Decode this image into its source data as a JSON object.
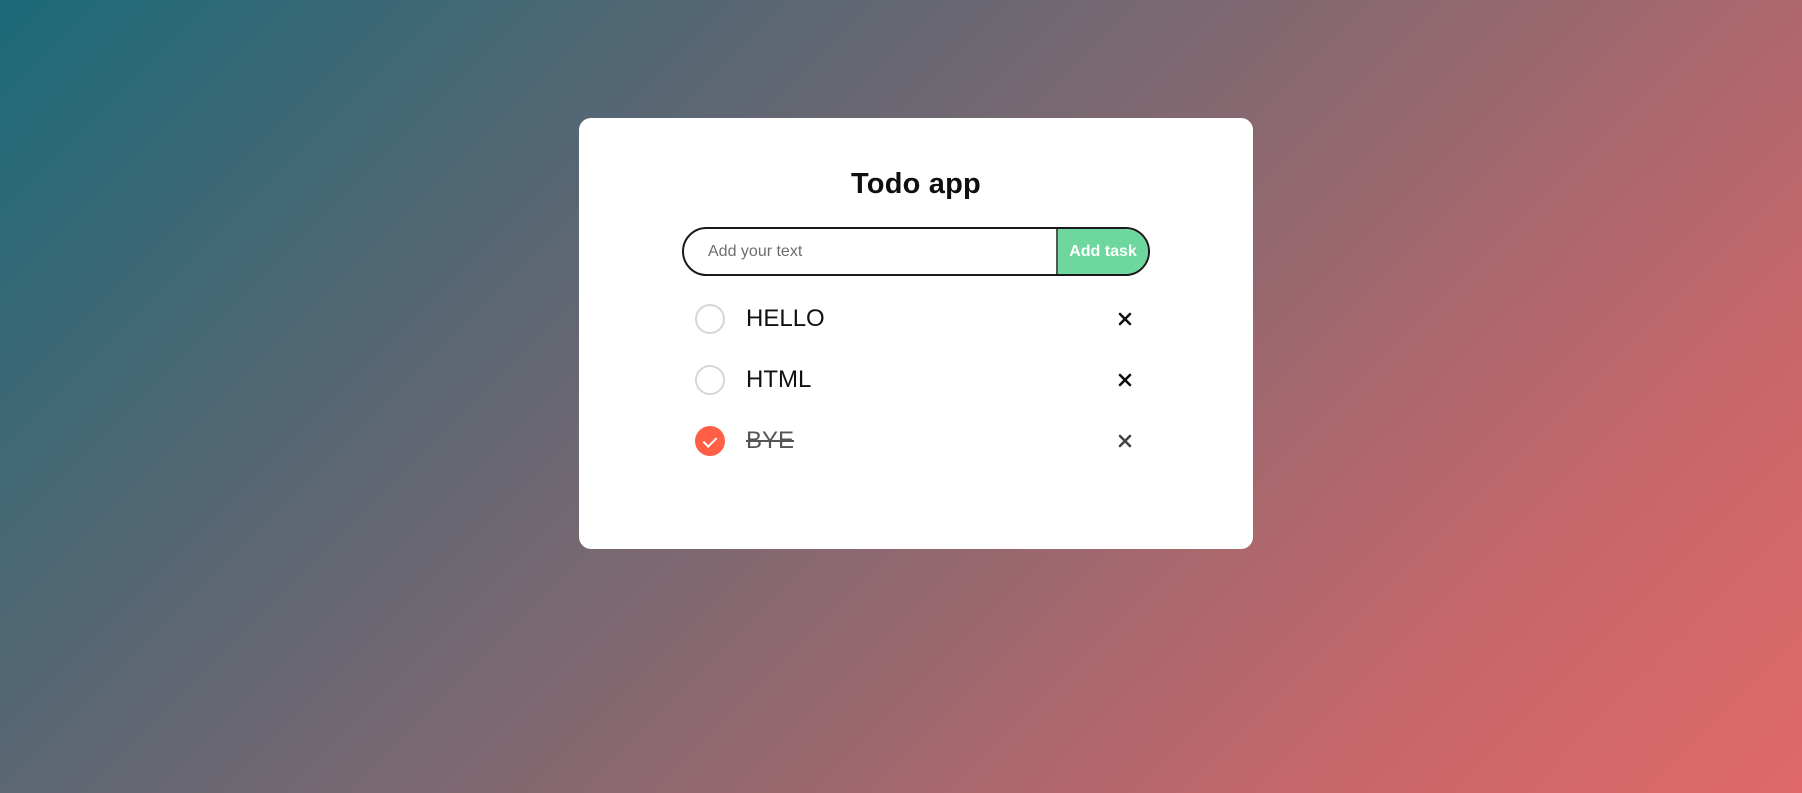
{
  "app": {
    "title": "Todo app"
  },
  "input": {
    "placeholder": "Add your text",
    "value": ""
  },
  "add_button": {
    "label": "Add task"
  },
  "tasks": [
    {
      "text": "HELLO",
      "done": false
    },
    {
      "text": "HTML",
      "done": false
    },
    {
      "text": "BYE",
      "done": true
    }
  ],
  "colors": {
    "add_button": "#6dd79e",
    "checked": "#ff5f45",
    "card": "#ffffff"
  },
  "icons": {
    "check": "check-circle-icon",
    "delete": "close-icon"
  }
}
